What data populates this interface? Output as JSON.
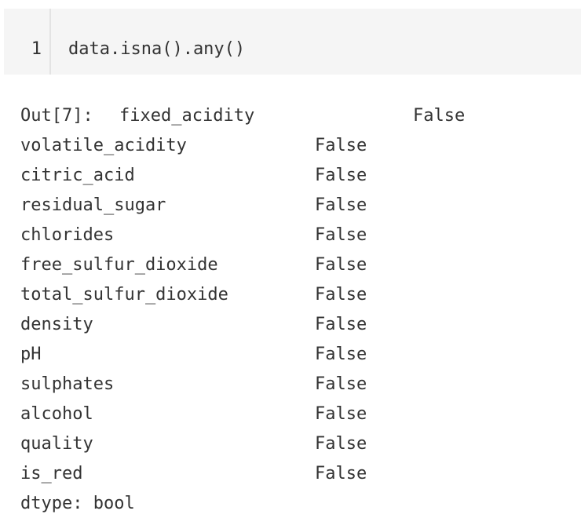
{
  "code_cell": {
    "line_number": "1",
    "code": "data.isna().any()"
  },
  "output": {
    "prompt": "Out[7]:",
    "rows": [
      {
        "name": "fixed_acidity",
        "value": "False"
      },
      {
        "name": "volatile_acidity",
        "value": "False"
      },
      {
        "name": "citric_acid",
        "value": "False"
      },
      {
        "name": "residual_sugar",
        "value": "False"
      },
      {
        "name": "chlorides",
        "value": "False"
      },
      {
        "name": "free_sulfur_dioxide",
        "value": "False"
      },
      {
        "name": "total_sulfur_dioxide",
        "value": "False"
      },
      {
        "name": "density",
        "value": "False"
      },
      {
        "name": "pH",
        "value": "False"
      },
      {
        "name": "sulphates",
        "value": "False"
      },
      {
        "name": "alcohol",
        "value": "False"
      },
      {
        "name": "quality",
        "value": "False"
      },
      {
        "name": "is_red",
        "value": "False"
      }
    ],
    "dtype": "dtype: bool"
  }
}
